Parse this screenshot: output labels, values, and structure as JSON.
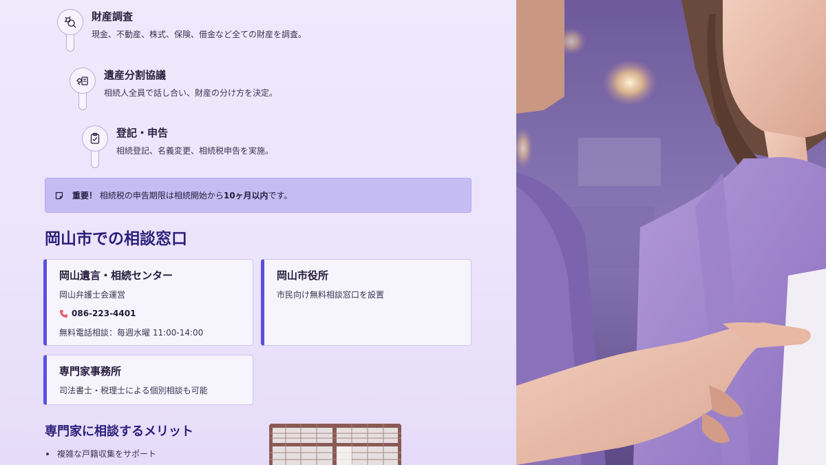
{
  "steps": [
    {
      "title": "財産調査",
      "desc": "現金、不動産、株式、保険、借金など全ての財産を調査。",
      "icon": "magnifier-asset-icon"
    },
    {
      "title": "遺産分割協議",
      "desc": "相続人全員で話し合い、財産の分け方を決定。",
      "icon": "handshake-document-icon"
    },
    {
      "title": "登記・申告",
      "desc": "相続登記、名義変更、相続税申告を実施。",
      "icon": "clipboard-check-icon"
    }
  ],
  "notice": {
    "label": "重要！",
    "text_before": "相続税の申告期限は相続開始から",
    "text_bold": "10ヶ月以内",
    "text_after": "です。"
  },
  "consult": {
    "heading": "岡山市での相談窓口",
    "cards": [
      {
        "title": "岡山遺言・相続センター",
        "sub": "岡山弁護士会運営",
        "phone": "086-223-4401",
        "note": "無料電話相談：毎週水曜 11:00-14:00"
      },
      {
        "title": "岡山市役所",
        "sub": "市民向け無料相談窓口を設置"
      },
      {
        "title": "専門家事務所",
        "sub": "司法書士・税理士による個別相談も可能"
      }
    ]
  },
  "merits": {
    "heading": "専門家に相談するメリット",
    "items": [
      "複雑な戸籍収集をサポート"
    ]
  },
  "colors": {
    "accent": "#5b4fe0",
    "heading": "#2b1f7a",
    "notice_bg": "#c5bcf3"
  }
}
